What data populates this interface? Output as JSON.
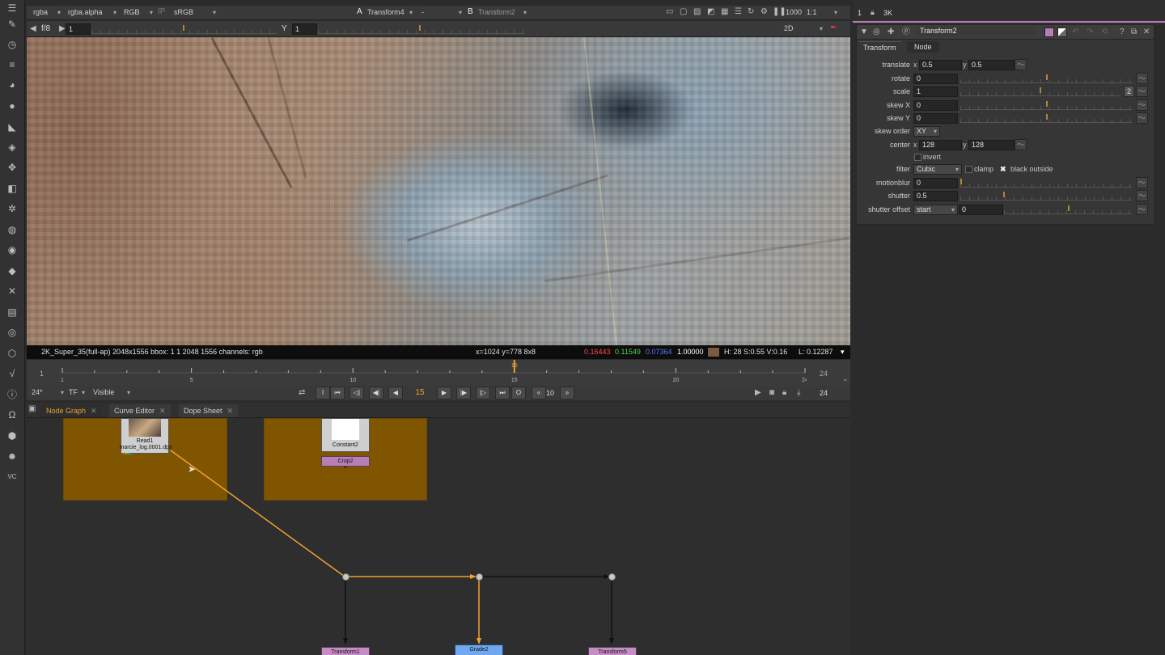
{
  "viewer_top": {
    "channels": "rgba",
    "alpha_channel": "rgba.alpha",
    "rgb": "RGB",
    "ip": "IP",
    "colorspace": "sRGB",
    "input_a_label": "A",
    "input_a": "Transform4",
    "input_a_op": "-",
    "input_b_label": "B",
    "input_b": "Transform2",
    "zoom_value": "1000",
    "zoom_ratio": "1:1"
  },
  "viewer_second": {
    "fstop": "f/8",
    "gain": "1",
    "y_label": "Y",
    "gamma": "1",
    "view_mode": "2D"
  },
  "info_bar": {
    "format": "2K_Super_35(full-ap) 2048x1556  bbox: 1 1 2048 1556 channels: rgb",
    "coords": "x=1024 y=778 8x8",
    "r": "0.16443",
    "g": "0.11549",
    "b": "0.07364",
    "a": "1.00000",
    "swatch_color": "#7a5a40",
    "hsv": "H: 28 S:0.55 V:0.16",
    "lum": "L: 0.12287"
  },
  "timeline": {
    "start_frame": "1",
    "end_frame": "24",
    "ticks": [
      {
        "label": "1",
        "frame": 1
      },
      {
        "label": "5",
        "frame": 5
      },
      {
        "label": "10",
        "frame": 10
      },
      {
        "label": "15",
        "frame": 15
      },
      {
        "label": "20",
        "frame": 20
      },
      {
        "label": "24",
        "frame": 24
      }
    ],
    "current_frame": "15",
    "current_frame_value": 15
  },
  "playback": {
    "fps": "24*",
    "tf": "TF",
    "visible": "Visible",
    "current_frame": "15",
    "step": "10",
    "end_frame": "24",
    "buttons": {
      "in_point": "I",
      "first": "⏮",
      "prev_key": "◁|",
      "prev_frame": "◀|",
      "play_back": "◀",
      "play": "▶",
      "next_frame": "|▶",
      "next_key": "|▷",
      "last": "⏭",
      "out_point": "O",
      "step_back": "«",
      "step_fwd": "»"
    }
  },
  "node_tabs": [
    {
      "label": "Node Graph",
      "active": true
    },
    {
      "label": "Curve Editor",
      "active": false
    },
    {
      "label": "Dope Sheet",
      "active": false
    }
  ],
  "nodes": {
    "read1_name": "Read1",
    "read1_file": "marcie_log.0001.dpx",
    "constant2": "Constant2",
    "crop2": "Crop2",
    "transform1": "Transform1",
    "grade2": "Grade2",
    "transform5": "Transform5"
  },
  "properties": {
    "pane_number": "1",
    "pane_extra": "3K",
    "node_name": "Transform2",
    "tabs": [
      {
        "label": "Transform",
        "active": true
      },
      {
        "label": "Node",
        "active": false
      }
    ],
    "translate_label": "translate",
    "translate_x_label": "x",
    "translate_x": "0.5",
    "translate_y_label": "y",
    "translate_y": "0.5",
    "rotate_label": "rotate",
    "rotate": "0",
    "scale_label": "scale",
    "scale": "1",
    "scale_channels": "2",
    "skewx_label": "skew X",
    "skewx": "0",
    "skewy_label": "skew Y",
    "skewy": "0",
    "skew_order_label": "skew order",
    "skew_order": "XY",
    "center_label": "center",
    "center_x_label": "x",
    "center_x": "128",
    "center_y_label": "y",
    "center_y": "128",
    "invert_label": "invert",
    "filter_label": "filter",
    "filter": "Cubic",
    "clamp_label": "clamp",
    "black_outside_label": "black outside",
    "motionblur_label": "motionblur",
    "motionblur": "0",
    "shutter_label": "shutter",
    "shutter": "0.5",
    "shutter_offset_label": "shutter offset",
    "shutter_offset": "start",
    "shutter_offset_value": "0"
  }
}
